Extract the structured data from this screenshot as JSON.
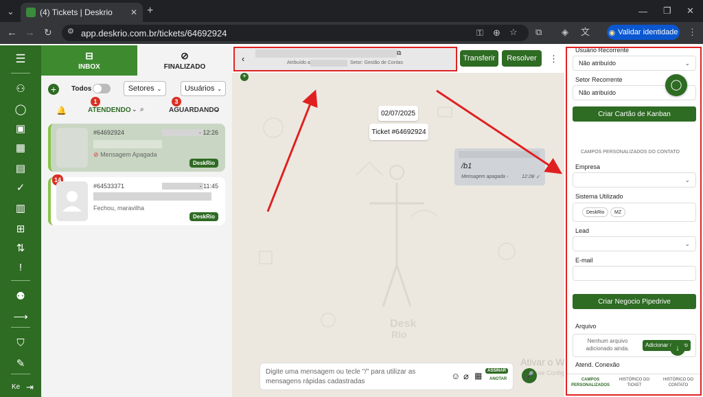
{
  "browser": {
    "tab_title": "(4) Tickets | Deskrio",
    "url": "app.deskrio.com.br/tickets/64692924",
    "verify_label": "Validar identidade"
  },
  "listpanel": {
    "tab_inbox": "INBOX",
    "tab_final": "FINALIZADO",
    "todos_label": "Todos",
    "setores_label": "Setores",
    "usuarios_label": "Usuários",
    "atendendo_label": "ATENDENDO",
    "atendendo_count": "1",
    "aguardando_label": "AGUARDANDO",
    "aguardando_count": "3",
    "tickets": [
      {
        "id": "#64692924",
        "time": "- 12:26",
        "message": "Mensagem Apagada",
        "tag": "DeskRio"
      },
      {
        "id": "#64533371",
        "time": "- 11:45",
        "message": "Fechou, maravilha",
        "tag": "DeskRio",
        "unread": "14"
      }
    ]
  },
  "nav": {
    "user_initials": "Ke"
  },
  "chat": {
    "header_attr": "Atribuído a:",
    "header_sector": "Setor: Gestão de Contas",
    "transfer_label": "Transferir",
    "resolve_label": "Resolver",
    "date_bubble": "02/07/2025",
    "ticket_bubble": "Ticket #64692924",
    "out_msg_text": "/b1",
    "out_msg_meta": "Mensagem apagada -",
    "out_msg_time": "12:26",
    "composer_placeholder": "Digite uma mensagem ou tecle \"/\" para utilizar as mensagens rápidas cadastradas",
    "sign_label": "ASSINAR",
    "note_label": "ANOTAR",
    "watermark_line1": "Ativar o Windows",
    "watermark_line2": "Acesse Configurações para ativar o Windows."
  },
  "right": {
    "usuario_recorrente_label": "Usuário Recorrente",
    "usuario_recorrente_value": "Não atribuído",
    "setor_recorrente_label": "Setor Recorrente",
    "setor_recorrente_value": "Não atribuído",
    "kanban_button": "Criar Cartão de Kanban",
    "custom_fields_title": "CAMPOS PERSONALIZADOS DO CONTATO",
    "empresa_label": "Empresa",
    "sistema_label": "Sistema Utilizado",
    "chip_1": "DeskRio",
    "chip_2": "MZ",
    "lead_label": "Lead",
    "email_label": "E-mail",
    "pipedrive_button": "Criar Negocio Pipedrive",
    "arquivo_label": "Arquivo",
    "no_file_text": "Nenhum arquivo adicionado ainda.",
    "add_file_button": "Adicionar arquivo",
    "atend_label": "Atend. Conexão",
    "bottom_tab_1": "CAMPOS PERSONALIZADOS",
    "bottom_tab_2": "HISTÓRICO DO TICKET",
    "bottom_tab_3": "HISTÓRICO DO CONTATO"
  },
  "colors": {
    "brand_green": "#2e6b23",
    "annotation_red": "#e02020"
  }
}
